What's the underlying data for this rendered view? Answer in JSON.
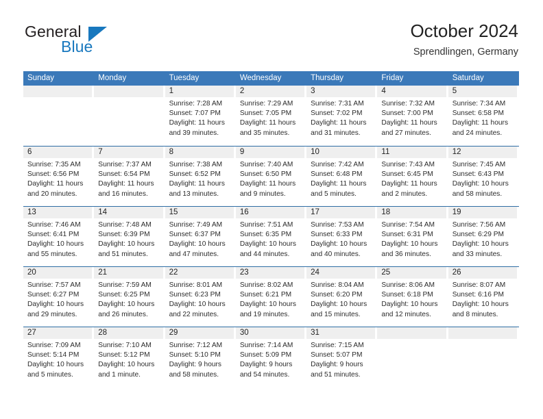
{
  "logo": {
    "word1": "General",
    "word2": "Blue",
    "triangle_color": "#1878be",
    "icon": "triangle-icon"
  },
  "header": {
    "title": "October 2024",
    "subtitle": "Sprendlingen, Germany"
  },
  "colors": {
    "header_blue": "#3b79b9",
    "rule_blue": "#2e6da4",
    "daynum_band": "#efefef",
    "logo_blue": "#1878be"
  },
  "weekday_headers": [
    "Sunday",
    "Monday",
    "Tuesday",
    "Wednesday",
    "Thursday",
    "Friday",
    "Saturday"
  ],
  "weeks": [
    [
      {
        "day": "",
        "lines": []
      },
      {
        "day": "",
        "lines": []
      },
      {
        "day": "1",
        "lines": [
          "Sunrise: 7:28 AM",
          "Sunset: 7:07 PM",
          "Daylight: 11 hours",
          "and 39 minutes."
        ]
      },
      {
        "day": "2",
        "lines": [
          "Sunrise: 7:29 AM",
          "Sunset: 7:05 PM",
          "Daylight: 11 hours",
          "and 35 minutes."
        ]
      },
      {
        "day": "3",
        "lines": [
          "Sunrise: 7:31 AM",
          "Sunset: 7:02 PM",
          "Daylight: 11 hours",
          "and 31 minutes."
        ]
      },
      {
        "day": "4",
        "lines": [
          "Sunrise: 7:32 AM",
          "Sunset: 7:00 PM",
          "Daylight: 11 hours",
          "and 27 minutes."
        ]
      },
      {
        "day": "5",
        "lines": [
          "Sunrise: 7:34 AM",
          "Sunset: 6:58 PM",
          "Daylight: 11 hours",
          "and 24 minutes."
        ]
      }
    ],
    [
      {
        "day": "6",
        "lines": [
          "Sunrise: 7:35 AM",
          "Sunset: 6:56 PM",
          "Daylight: 11 hours",
          "and 20 minutes."
        ]
      },
      {
        "day": "7",
        "lines": [
          "Sunrise: 7:37 AM",
          "Sunset: 6:54 PM",
          "Daylight: 11 hours",
          "and 16 minutes."
        ]
      },
      {
        "day": "8",
        "lines": [
          "Sunrise: 7:38 AM",
          "Sunset: 6:52 PM",
          "Daylight: 11 hours",
          "and 13 minutes."
        ]
      },
      {
        "day": "9",
        "lines": [
          "Sunrise: 7:40 AM",
          "Sunset: 6:50 PM",
          "Daylight: 11 hours",
          "and 9 minutes."
        ]
      },
      {
        "day": "10",
        "lines": [
          "Sunrise: 7:42 AM",
          "Sunset: 6:48 PM",
          "Daylight: 11 hours",
          "and 5 minutes."
        ]
      },
      {
        "day": "11",
        "lines": [
          "Sunrise: 7:43 AM",
          "Sunset: 6:45 PM",
          "Daylight: 11 hours",
          "and 2 minutes."
        ]
      },
      {
        "day": "12",
        "lines": [
          "Sunrise: 7:45 AM",
          "Sunset: 6:43 PM",
          "Daylight: 10 hours",
          "and 58 minutes."
        ]
      }
    ],
    [
      {
        "day": "13",
        "lines": [
          "Sunrise: 7:46 AM",
          "Sunset: 6:41 PM",
          "Daylight: 10 hours",
          "and 55 minutes."
        ]
      },
      {
        "day": "14",
        "lines": [
          "Sunrise: 7:48 AM",
          "Sunset: 6:39 PM",
          "Daylight: 10 hours",
          "and 51 minutes."
        ]
      },
      {
        "day": "15",
        "lines": [
          "Sunrise: 7:49 AM",
          "Sunset: 6:37 PM",
          "Daylight: 10 hours",
          "and 47 minutes."
        ]
      },
      {
        "day": "16",
        "lines": [
          "Sunrise: 7:51 AM",
          "Sunset: 6:35 PM",
          "Daylight: 10 hours",
          "and 44 minutes."
        ]
      },
      {
        "day": "17",
        "lines": [
          "Sunrise: 7:53 AM",
          "Sunset: 6:33 PM",
          "Daylight: 10 hours",
          "and 40 minutes."
        ]
      },
      {
        "day": "18",
        "lines": [
          "Sunrise: 7:54 AM",
          "Sunset: 6:31 PM",
          "Daylight: 10 hours",
          "and 36 minutes."
        ]
      },
      {
        "day": "19",
        "lines": [
          "Sunrise: 7:56 AM",
          "Sunset: 6:29 PM",
          "Daylight: 10 hours",
          "and 33 minutes."
        ]
      }
    ],
    [
      {
        "day": "20",
        "lines": [
          "Sunrise: 7:57 AM",
          "Sunset: 6:27 PM",
          "Daylight: 10 hours",
          "and 29 minutes."
        ]
      },
      {
        "day": "21",
        "lines": [
          "Sunrise: 7:59 AM",
          "Sunset: 6:25 PM",
          "Daylight: 10 hours",
          "and 26 minutes."
        ]
      },
      {
        "day": "22",
        "lines": [
          "Sunrise: 8:01 AM",
          "Sunset: 6:23 PM",
          "Daylight: 10 hours",
          "and 22 minutes."
        ]
      },
      {
        "day": "23",
        "lines": [
          "Sunrise: 8:02 AM",
          "Sunset: 6:21 PM",
          "Daylight: 10 hours",
          "and 19 minutes."
        ]
      },
      {
        "day": "24",
        "lines": [
          "Sunrise: 8:04 AM",
          "Sunset: 6:20 PM",
          "Daylight: 10 hours",
          "and 15 minutes."
        ]
      },
      {
        "day": "25",
        "lines": [
          "Sunrise: 8:06 AM",
          "Sunset: 6:18 PM",
          "Daylight: 10 hours",
          "and 12 minutes."
        ]
      },
      {
        "day": "26",
        "lines": [
          "Sunrise: 8:07 AM",
          "Sunset: 6:16 PM",
          "Daylight: 10 hours",
          "and 8 minutes."
        ]
      }
    ],
    [
      {
        "day": "27",
        "lines": [
          "Sunrise: 7:09 AM",
          "Sunset: 5:14 PM",
          "Daylight: 10 hours",
          "and 5 minutes."
        ]
      },
      {
        "day": "28",
        "lines": [
          "Sunrise: 7:10 AM",
          "Sunset: 5:12 PM",
          "Daylight: 10 hours",
          "and 1 minute."
        ]
      },
      {
        "day": "29",
        "lines": [
          "Sunrise: 7:12 AM",
          "Sunset: 5:10 PM",
          "Daylight: 9 hours",
          "and 58 minutes."
        ]
      },
      {
        "day": "30",
        "lines": [
          "Sunrise: 7:14 AM",
          "Sunset: 5:09 PM",
          "Daylight: 9 hours",
          "and 54 minutes."
        ]
      },
      {
        "day": "31",
        "lines": [
          "Sunrise: 7:15 AM",
          "Sunset: 5:07 PM",
          "Daylight: 9 hours",
          "and 51 minutes."
        ]
      },
      {
        "day": "",
        "lines": []
      },
      {
        "day": "",
        "lines": []
      }
    ]
  ]
}
